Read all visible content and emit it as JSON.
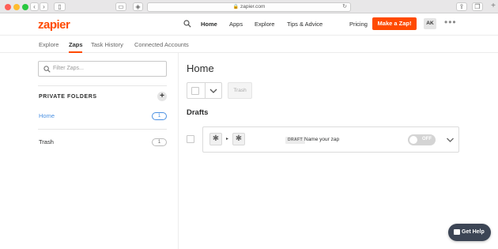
{
  "browser": {
    "url": "zapier.com"
  },
  "header": {
    "logo": "zapier",
    "nav": [
      "Home",
      "Apps",
      "Explore",
      "Tips & Advice"
    ],
    "active_nav": "Home",
    "pricing": "Pricing",
    "make_zap": "Make a Zap!",
    "avatar_initials": "AK",
    "more": "•••"
  },
  "subnav": {
    "items": [
      "Explore",
      "Zaps",
      "Task History",
      "Connected Accounts"
    ],
    "active": "Zaps"
  },
  "sidebar": {
    "search_placeholder": "Filter Zaps...",
    "heading": "PRIVATE FOLDERS",
    "add": "+",
    "folders": [
      {
        "label": "Home",
        "count": "1",
        "active": true
      },
      {
        "label": "Trash",
        "count": "1",
        "active": false
      }
    ]
  },
  "main": {
    "title": "Home",
    "trash_button": "Trash",
    "section_title": "Drafts",
    "zaps": [
      {
        "badge": "DRAFT",
        "name": "Name your zap",
        "toggle": "OFF"
      }
    ]
  },
  "help": {
    "label": "Get Help"
  },
  "colors": {
    "brand": "#ff4a00",
    "link": "#4a90e2",
    "help_bg": "#3c4555"
  }
}
